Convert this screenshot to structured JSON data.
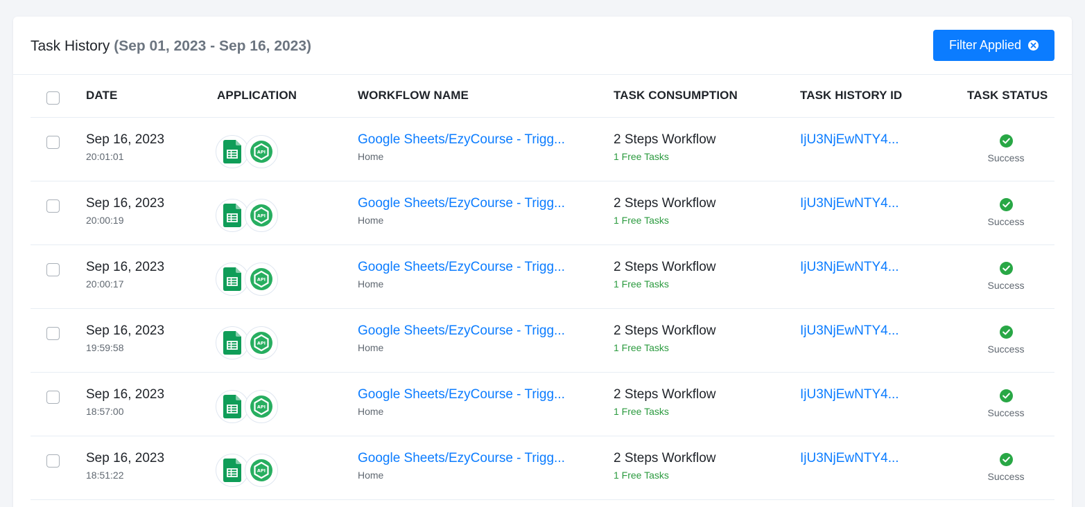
{
  "header": {
    "title": "Task History",
    "date_range": "(Sep 01, 2023 - Sep 16, 2023)",
    "filter_button": "Filter Applied"
  },
  "table": {
    "columns": [
      "DATE",
      "APPLICATION",
      "WORKFLOW NAME",
      "TASK CONSUMPTION",
      "TASK HISTORY ID",
      "TASK STATUS"
    ],
    "rows": [
      {
        "date": "Sep 16, 2023",
        "time": "20:01:01",
        "apps": [
          "google-sheets-icon",
          "api-icon"
        ],
        "workflow": "Google Sheets/EzyCourse - Trigg...",
        "folder": "Home",
        "consumption": "2 Steps Workflow",
        "tasks": "1 Free Tasks",
        "history_id": "IjU3NjEwNTY4...",
        "status": "Success"
      },
      {
        "date": "Sep 16, 2023",
        "time": "20:00:19",
        "apps": [
          "google-sheets-icon",
          "api-icon"
        ],
        "workflow": "Google Sheets/EzyCourse - Trigg...",
        "folder": "Home",
        "consumption": "2 Steps Workflow",
        "tasks": "1 Free Tasks",
        "history_id": "IjU3NjEwNTY4...",
        "status": "Success"
      },
      {
        "date": "Sep 16, 2023",
        "time": "20:00:17",
        "apps": [
          "google-sheets-icon",
          "api-icon"
        ],
        "workflow": "Google Sheets/EzyCourse - Trigg...",
        "folder": "Home",
        "consumption": "2 Steps Workflow",
        "tasks": "1 Free Tasks",
        "history_id": "IjU3NjEwNTY4...",
        "status": "Success"
      },
      {
        "date": "Sep 16, 2023",
        "time": "19:59:58",
        "apps": [
          "google-sheets-icon",
          "api-icon"
        ],
        "workflow": "Google Sheets/EzyCourse - Trigg...",
        "folder": "Home",
        "consumption": "2 Steps Workflow",
        "tasks": "1 Free Tasks",
        "history_id": "IjU3NjEwNTY4...",
        "status": "Success"
      },
      {
        "date": "Sep 16, 2023",
        "time": "18:57:00",
        "apps": [
          "google-sheets-icon",
          "api-icon"
        ],
        "workflow": "Google Sheets/EzyCourse - Trigg...",
        "folder": "Home",
        "consumption": "2 Steps Workflow",
        "tasks": "1 Free Tasks",
        "history_id": "IjU3NjEwNTY4...",
        "status": "Success"
      },
      {
        "date": "Sep 16, 2023",
        "time": "18:51:22",
        "apps": [
          "google-sheets-icon",
          "api-icon"
        ],
        "workflow": "Google Sheets/EzyCourse - Trigg...",
        "folder": "Home",
        "consumption": "2 Steps Workflow",
        "tasks": "1 Free Tasks",
        "history_id": "IjU3NjEwNTY4...",
        "status": "Success"
      }
    ]
  },
  "colors": {
    "accent": "#0b7cff",
    "success": "#28a745",
    "free_tasks": "#2a9a3e",
    "sheets_green": "#0f9d58"
  }
}
